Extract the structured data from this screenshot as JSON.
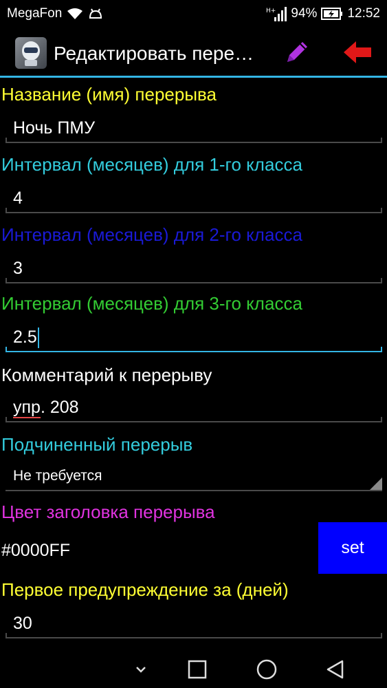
{
  "status_bar": {
    "carrier": "MegaFon",
    "battery": "94%",
    "time": "12:52",
    "icons": [
      "wifi-icon",
      "android-debug-icon",
      "signal-icon",
      "battery-icon"
    ]
  },
  "action_bar": {
    "title": "Редактировать пере…",
    "icons": [
      "app-icon",
      "pencil-icon",
      "back-arrow-icon"
    ]
  },
  "form": {
    "name": {
      "label": "Название (имя) перерыва",
      "value": "Ночь ПМУ",
      "label_color": "#FFFF33"
    },
    "class1": {
      "label": "Интервал (месяцев) для 1-го класса",
      "value": "4",
      "label_color": "#33CCDD"
    },
    "class2": {
      "label": "Интервал (месяцев) для 2-го класса",
      "value": "3",
      "label_color": "#1A1AD6"
    },
    "class3": {
      "label": "Интервал (месяцев) для 3-го класса",
      "value": "2.5",
      "label_color": "#33CC33"
    },
    "comment": {
      "label": "Комментарий к перерыву",
      "value_underlined": "упр",
      "value_rest": ". 208",
      "label_color": "#FFFFFF"
    },
    "subordinate": {
      "label": "Подчиненный перерыв",
      "value": "Не требуется",
      "label_color": "#33CCDD"
    },
    "header_color": {
      "label": "Цвет заголовка перерыва",
      "value": "#0000FF",
      "button_label": "set",
      "label_color": "#E033E0",
      "swatch": "#0000FF"
    },
    "first_warning": {
      "label": "Первое предупреждение за (дней)",
      "value": "30",
      "label_color": "#FFFF33"
    }
  },
  "nav_bar": {
    "icons": [
      "chevron-down-icon",
      "recent-apps-icon",
      "home-icon",
      "back-icon"
    ]
  },
  "accent_color": "#33B5E5"
}
